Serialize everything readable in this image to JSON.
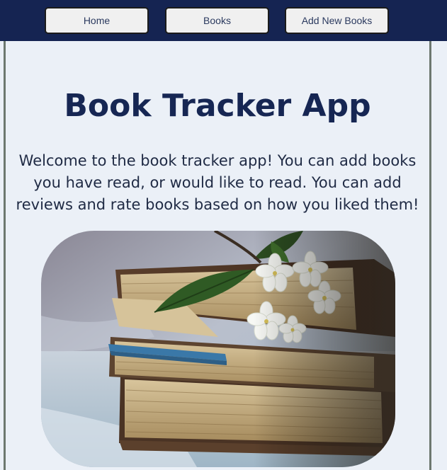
{
  "nav": {
    "home": "Home",
    "books": "Books",
    "add_new": "Add New Books"
  },
  "main": {
    "title": "Book Tracker App",
    "intro": "Welcome to the book tracker app! You can add books you have read, or would like to read. You can add reviews and rate books based on how you liked them!"
  },
  "colors": {
    "navbar": "#152452",
    "background": "#ebf0f7",
    "title": "#162653"
  }
}
